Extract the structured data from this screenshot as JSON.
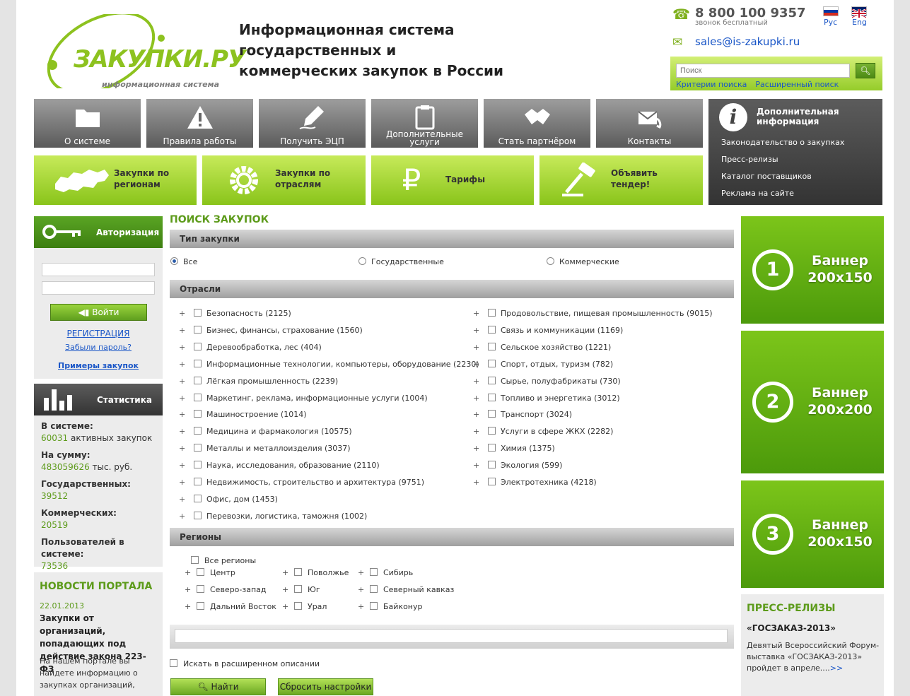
{
  "header": {
    "logo_word": "ЗАКУПКИ.РУ",
    "logo_sub": "информационная система",
    "title": "Информационная система государственных и коммерческих закупок в России",
    "phone": "8 800 100 9357",
    "phone_note": "звонок бесплатный",
    "email": "sales@is-zakupki.ru",
    "lang_ru": "Рус",
    "lang_en": "Eng",
    "search_placeholder": "Поиск",
    "search_criteria": "Критерии поиска",
    "search_advanced": "Расширенный поиск"
  },
  "nav_grey": [
    {
      "label": "О системе",
      "icon": "folder-icon"
    },
    {
      "label": "Правила работы",
      "icon": "warning-icon"
    },
    {
      "label": "Получить ЭЦП",
      "icon": "pen-icon"
    },
    {
      "label": "Дополнительные услуги",
      "icon": "clipboard-icon"
    },
    {
      "label": "Стать партнёром",
      "icon": "handshake-icon"
    },
    {
      "label": "Контакты",
      "icon": "mail-phone-icon"
    }
  ],
  "info_panel": {
    "title": "Дополнительная информация",
    "links": [
      "Законодательство о закупках",
      "Пресс-релизы",
      "Каталог поставщиков",
      "Реклама на сайте"
    ]
  },
  "nav_green": [
    {
      "label": "Закупки по регионам",
      "icon": "russia-map-icon"
    },
    {
      "label": "Закупки по отраслям",
      "icon": "gear-icon"
    },
    {
      "label": "Тарифы",
      "icon": "ruble-icon"
    },
    {
      "label": "Объявить тендер!",
      "icon": "gavel-icon"
    }
  ],
  "auth": {
    "title": "Авторизация",
    "login_button": "Войти",
    "register": "РЕГИСТРАЦИЯ",
    "forgot": "Забыли пароль?",
    "examples": "Примеры закупок"
  },
  "stats": {
    "title": "Статистика",
    "in_system_label": "В системе:",
    "in_system_value": "60031",
    "in_system_unit": "активных закупок",
    "sum_label": "На сумму:",
    "sum_value": "483059626",
    "sum_unit": "тыс. руб.",
    "gov_label": "Государственных:",
    "gov_value": "39512",
    "com_label": "Коммерческих:",
    "com_value": "20519",
    "users_label": "Пользователей в системе:",
    "users_value": "73536"
  },
  "news": {
    "title": "НОВОСТИ ПОРТАЛА",
    "date": "22.01.2013",
    "headline": "Закупки от организаций, попадающих под действие закона 223-ФЗ",
    "text": "На нашем портале вы найдете информацию о закупках организаций,"
  },
  "search": {
    "title": "ПОИСК ЗАКУПОК",
    "type_header": "Тип закупки",
    "type_options": [
      "Все",
      "Государственные",
      "Коммерческие"
    ],
    "industries_header": "Отрасли",
    "industries_left": [
      "Безопасность (2125)",
      "Бизнес, финансы, страхование (1560)",
      "Деревообработка, лес (404)",
      "Информационные технологии, компьютеры, оборудование (2230)",
      "Лёгкая промышленность (2239)",
      "Маркетинг, реклама, информационные услуги (1004)",
      "Машиностроение (1014)",
      "Медицина и фармакология (10575)",
      "Металлы и металлоизделия (3037)",
      "Наука, исследования, образование (2110)",
      "Недвижимость, строительство и архитектура (9751)",
      "Офис, дом (1453)",
      "Перевозки, логистика, таможня (1002)"
    ],
    "industries_right": [
      "Продовольствие, пищевая промышленность (9015)",
      "Связь и коммуникации (1169)",
      "Сельское хозяйство (1221)",
      "Спорт, отдых, туризм (782)",
      "Сырье, полуфабрикаты (730)",
      "Топливо и энергетика (3012)",
      "Транспорт (3024)",
      "Услуги в сфере ЖКХ (2282)",
      "Химия (1375)",
      "Экология (599)",
      "Электротехника (4218)"
    ],
    "regions_header": "Регионы",
    "all_regions": "Все регионы",
    "regions": [
      [
        "Центр",
        "Поволжье",
        "Сибирь"
      ],
      [
        "Северо-запад",
        "Юг",
        "Северный кавказ"
      ],
      [
        "Дальний Восток",
        "Урал",
        "Байконур"
      ]
    ],
    "extended_check": "Искать в расширенном описании",
    "find_button": "Найти",
    "reset_button": "Сбросить настройки"
  },
  "banners": [
    {
      "num": "1",
      "text": "Баннер 200x150"
    },
    {
      "num": "2",
      "text": "Баннер 200x200"
    },
    {
      "num": "3",
      "text": "Баннер 200x150"
    }
  ],
  "press": {
    "title": "ПРЕСС-РЕЛИЗЫ",
    "headline": "«ГОСЗАКАЗ-2013»",
    "text": "Девятый Всероссийский Форум-выставка «ГОСЗАКАЗ-2013» пройдет в апреле....",
    "more": ">>"
  },
  "colors": {
    "accent_green": "#8dc21f",
    "dark_green": "#5d9b1b",
    "link": "#1a56c7"
  }
}
